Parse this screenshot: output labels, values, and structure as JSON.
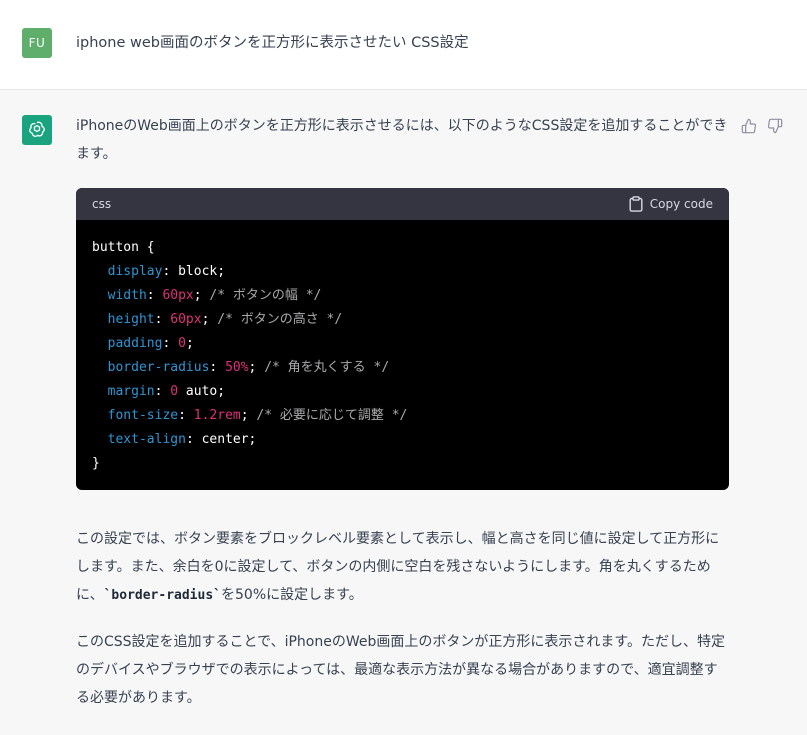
{
  "user": {
    "avatar": "FU",
    "message": "iphone web画面のボタンを正方形に表示させたい CSS設定"
  },
  "assistant": {
    "intro": "iPhoneのWeb画面上のボタンを正方形に表示させるには、以下のようなCSS設定を追加することができます。",
    "code": {
      "language": "css",
      "copy_label": "Copy code",
      "open_line": "button {",
      "close_line": "}",
      "lines": [
        {
          "prop": "display",
          "num": "",
          "rest": "block;",
          "comment": ""
        },
        {
          "prop": "width",
          "num": "60px",
          "rest": ";",
          "comment": "/* ボタンの幅 */"
        },
        {
          "prop": "height",
          "num": "60px",
          "rest": ";",
          "comment": "/* ボタンの高さ */"
        },
        {
          "prop": "padding",
          "num": "0",
          "rest": ";",
          "comment": ""
        },
        {
          "prop": "border-radius",
          "num": "50%",
          "rest": ";",
          "comment": "/* 角を丸くする */"
        },
        {
          "prop": "margin",
          "num": "0",
          "rest": " auto;",
          "comment": ""
        },
        {
          "prop": "font-size",
          "num": "1.2rem",
          "rest": ";",
          "comment": "/* 必要に応じて調整 */"
        },
        {
          "prop": "text-align",
          "num": "",
          "rest": "center;",
          "comment": ""
        }
      ]
    },
    "para1_part1": "この設定では、ボタン要素をブロックレベル要素として表示し、幅と高さを同じ値に設定して正方形にします。また、余白を0に設定して、ボタンの内側に空白を残さないようにします。角を丸くするために、",
    "para1_code": "`border-radius`",
    "para1_part2": "を50%に設定します。",
    "para2": "このCSS設定を追加することで、iPhoneのWeb画面上のボタンが正方形に表示されます。ただし、特定のデバイスやブラウザでの表示によっては、最適な表示方法が異なる場合がありますので、適宜調整する必要があります。"
  },
  "icons": {
    "assistant_avatar": "openai-logo-icon",
    "copy": "clipboard-icon",
    "like": "thumbs-up-icon",
    "dislike": "thumbs-down-icon"
  },
  "colors": {
    "user_avatar": "#5fae6b",
    "assistant_avatar": "#19a37f",
    "code_bg": "#000000",
    "code_header": "#343541",
    "property": "#2e95d3",
    "number": "#df3079",
    "comment": "#a9aaab"
  }
}
